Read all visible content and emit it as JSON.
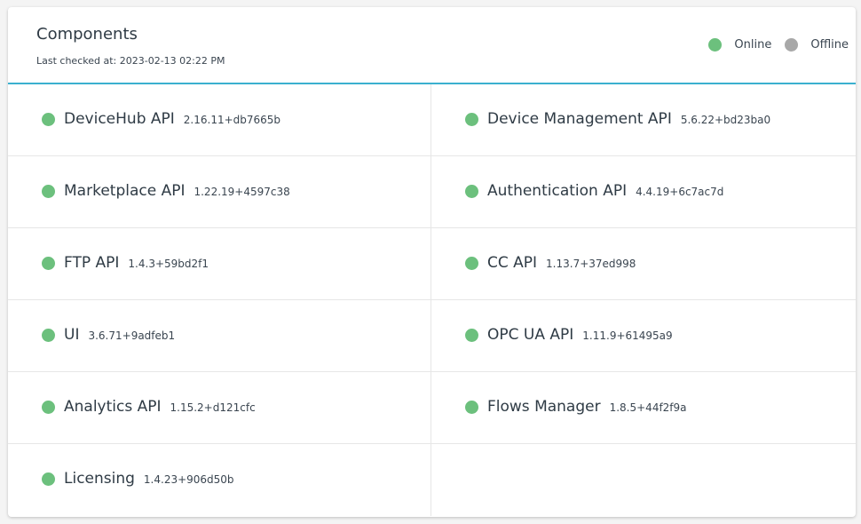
{
  "header": {
    "title": "Components",
    "last_checked_label": "Last checked at:",
    "last_checked_value": "2023-02-13 02:22 PM"
  },
  "legend": {
    "online_label": "Online",
    "offline_label": "Offline",
    "online_color": "#6cc07d",
    "offline_color": "#a8a8a8"
  },
  "components": [
    {
      "name": "DeviceHub API",
      "version": "2.16.11+db7665b",
      "status": "online"
    },
    {
      "name": "Device Management API",
      "version": "5.6.22+bd23ba0",
      "status": "online"
    },
    {
      "name": "Marketplace API",
      "version": "1.22.19+4597c38",
      "status": "online"
    },
    {
      "name": "Authentication API",
      "version": "4.4.19+6c7ac7d",
      "status": "online"
    },
    {
      "name": "FTP API",
      "version": "1.4.3+59bd2f1",
      "status": "online"
    },
    {
      "name": "CC API",
      "version": "1.13.7+37ed998",
      "status": "online"
    },
    {
      "name": "UI",
      "version": "3.6.71+9adfeb1",
      "status": "online"
    },
    {
      "name": "OPC UA API",
      "version": "1.11.9+61495a9",
      "status": "online"
    },
    {
      "name": "Analytics API",
      "version": "1.15.2+d121cfc",
      "status": "online"
    },
    {
      "name": "Flows Manager",
      "version": "1.8.5+44f2f9a",
      "status": "online"
    },
    {
      "name": "Licensing",
      "version": "1.4.23+906d50b",
      "status": "online"
    }
  ]
}
